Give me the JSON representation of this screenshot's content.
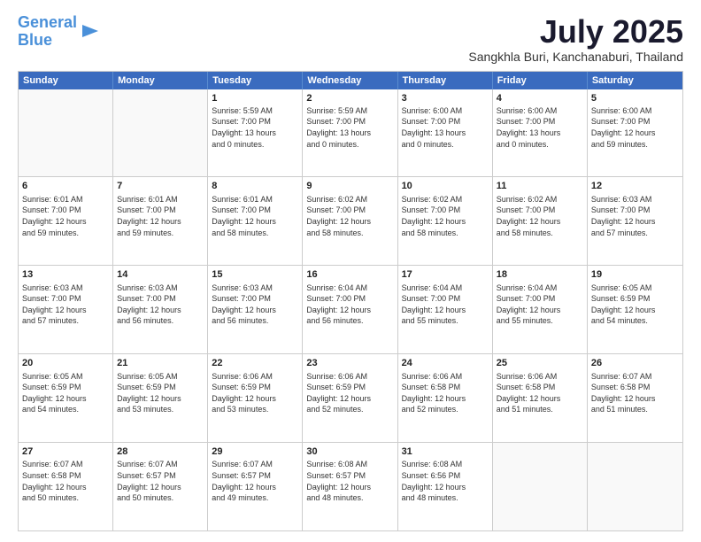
{
  "header": {
    "logo_line1": "General",
    "logo_line2": "Blue",
    "month": "July 2025",
    "location": "Sangkhla Buri, Kanchanaburi, Thailand"
  },
  "weekdays": [
    "Sunday",
    "Monday",
    "Tuesday",
    "Wednesday",
    "Thursday",
    "Friday",
    "Saturday"
  ],
  "rows": [
    [
      {
        "day": "",
        "info": ""
      },
      {
        "day": "",
        "info": ""
      },
      {
        "day": "1",
        "info": "Sunrise: 5:59 AM\nSunset: 7:00 PM\nDaylight: 13 hours\nand 0 minutes."
      },
      {
        "day": "2",
        "info": "Sunrise: 5:59 AM\nSunset: 7:00 PM\nDaylight: 13 hours\nand 0 minutes."
      },
      {
        "day": "3",
        "info": "Sunrise: 6:00 AM\nSunset: 7:00 PM\nDaylight: 13 hours\nand 0 minutes."
      },
      {
        "day": "4",
        "info": "Sunrise: 6:00 AM\nSunset: 7:00 PM\nDaylight: 13 hours\nand 0 minutes."
      },
      {
        "day": "5",
        "info": "Sunrise: 6:00 AM\nSunset: 7:00 PM\nDaylight: 12 hours\nand 59 minutes."
      }
    ],
    [
      {
        "day": "6",
        "info": "Sunrise: 6:01 AM\nSunset: 7:00 PM\nDaylight: 12 hours\nand 59 minutes."
      },
      {
        "day": "7",
        "info": "Sunrise: 6:01 AM\nSunset: 7:00 PM\nDaylight: 12 hours\nand 59 minutes."
      },
      {
        "day": "8",
        "info": "Sunrise: 6:01 AM\nSunset: 7:00 PM\nDaylight: 12 hours\nand 58 minutes."
      },
      {
        "day": "9",
        "info": "Sunrise: 6:02 AM\nSunset: 7:00 PM\nDaylight: 12 hours\nand 58 minutes."
      },
      {
        "day": "10",
        "info": "Sunrise: 6:02 AM\nSunset: 7:00 PM\nDaylight: 12 hours\nand 58 minutes."
      },
      {
        "day": "11",
        "info": "Sunrise: 6:02 AM\nSunset: 7:00 PM\nDaylight: 12 hours\nand 58 minutes."
      },
      {
        "day": "12",
        "info": "Sunrise: 6:03 AM\nSunset: 7:00 PM\nDaylight: 12 hours\nand 57 minutes."
      }
    ],
    [
      {
        "day": "13",
        "info": "Sunrise: 6:03 AM\nSunset: 7:00 PM\nDaylight: 12 hours\nand 57 minutes."
      },
      {
        "day": "14",
        "info": "Sunrise: 6:03 AM\nSunset: 7:00 PM\nDaylight: 12 hours\nand 56 minutes."
      },
      {
        "day": "15",
        "info": "Sunrise: 6:03 AM\nSunset: 7:00 PM\nDaylight: 12 hours\nand 56 minutes."
      },
      {
        "day": "16",
        "info": "Sunrise: 6:04 AM\nSunset: 7:00 PM\nDaylight: 12 hours\nand 56 minutes."
      },
      {
        "day": "17",
        "info": "Sunrise: 6:04 AM\nSunset: 7:00 PM\nDaylight: 12 hours\nand 55 minutes."
      },
      {
        "day": "18",
        "info": "Sunrise: 6:04 AM\nSunset: 7:00 PM\nDaylight: 12 hours\nand 55 minutes."
      },
      {
        "day": "19",
        "info": "Sunrise: 6:05 AM\nSunset: 6:59 PM\nDaylight: 12 hours\nand 54 minutes."
      }
    ],
    [
      {
        "day": "20",
        "info": "Sunrise: 6:05 AM\nSunset: 6:59 PM\nDaylight: 12 hours\nand 54 minutes."
      },
      {
        "day": "21",
        "info": "Sunrise: 6:05 AM\nSunset: 6:59 PM\nDaylight: 12 hours\nand 53 minutes."
      },
      {
        "day": "22",
        "info": "Sunrise: 6:06 AM\nSunset: 6:59 PM\nDaylight: 12 hours\nand 53 minutes."
      },
      {
        "day": "23",
        "info": "Sunrise: 6:06 AM\nSunset: 6:59 PM\nDaylight: 12 hours\nand 52 minutes."
      },
      {
        "day": "24",
        "info": "Sunrise: 6:06 AM\nSunset: 6:58 PM\nDaylight: 12 hours\nand 52 minutes."
      },
      {
        "day": "25",
        "info": "Sunrise: 6:06 AM\nSunset: 6:58 PM\nDaylight: 12 hours\nand 51 minutes."
      },
      {
        "day": "26",
        "info": "Sunrise: 6:07 AM\nSunset: 6:58 PM\nDaylight: 12 hours\nand 51 minutes."
      }
    ],
    [
      {
        "day": "27",
        "info": "Sunrise: 6:07 AM\nSunset: 6:58 PM\nDaylight: 12 hours\nand 50 minutes."
      },
      {
        "day": "28",
        "info": "Sunrise: 6:07 AM\nSunset: 6:57 PM\nDaylight: 12 hours\nand 50 minutes."
      },
      {
        "day": "29",
        "info": "Sunrise: 6:07 AM\nSunset: 6:57 PM\nDaylight: 12 hours\nand 49 minutes."
      },
      {
        "day": "30",
        "info": "Sunrise: 6:08 AM\nSunset: 6:57 PM\nDaylight: 12 hours\nand 48 minutes."
      },
      {
        "day": "31",
        "info": "Sunrise: 6:08 AM\nSunset: 6:56 PM\nDaylight: 12 hours\nand 48 minutes."
      },
      {
        "day": "",
        "info": ""
      },
      {
        "day": "",
        "info": ""
      }
    ]
  ]
}
